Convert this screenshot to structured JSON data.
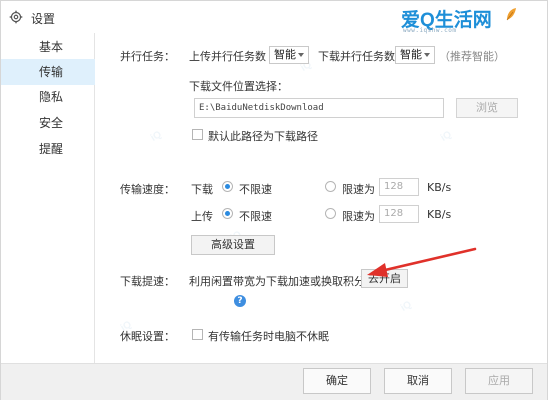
{
  "window": {
    "title": "设置"
  },
  "brand": {
    "name": "爱Q生活网",
    "url": "www.iqshw.com"
  },
  "sidebar": {
    "items": [
      {
        "label": "基本",
        "active": false
      },
      {
        "label": "传输",
        "active": true
      },
      {
        "label": "隐私",
        "active": false
      },
      {
        "label": "安全",
        "active": false
      },
      {
        "label": "提醒",
        "active": false
      }
    ]
  },
  "parallel": {
    "label": "并行任务：",
    "upload_label": "上传并行任务数",
    "upload_value": "智能",
    "download_label": "下载并行任务数",
    "download_value": "智能",
    "hint": "（推荐智能）"
  },
  "download_location": {
    "label": "下载文件位置选择：",
    "path": "E:\\BaiduNetdiskDownload",
    "browse_label": "浏览",
    "default_checkbox_label": "默认此路径为下载路径",
    "default_checked": false
  },
  "speed": {
    "label": "传输速度：",
    "download_label": "下载",
    "upload_label": "上传",
    "unlimited_label": "不限速",
    "limit_label": "限速为",
    "download_limit": "128",
    "upload_limit": "128",
    "unit": "KB/s",
    "advanced_label": "高级设置"
  },
  "boost": {
    "label": "下载提速：",
    "text": "利用闲置带宽为下载加速或换取积分",
    "button_label": "去开启"
  },
  "sleep": {
    "label": "休眠设置：",
    "checkbox_label": "有传输任务时电脑不休眠",
    "checked": false
  },
  "footer": {
    "ok_label": "确定",
    "cancel_label": "取消",
    "apply_label": "应用"
  },
  "colors": {
    "accent": "#2b8be0",
    "sidebar_active_bg": "#dff0fc",
    "arrow": "#e0312a",
    "brand": "#1e8fd8"
  }
}
